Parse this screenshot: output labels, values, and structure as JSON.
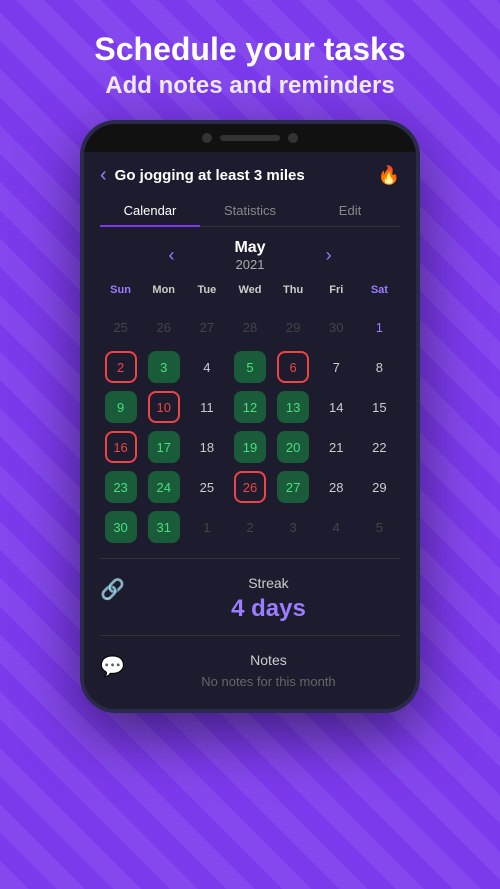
{
  "header": {
    "headline": "Schedule your tasks",
    "subheadline": "Add notes and reminders"
  },
  "app": {
    "title": "Go jogging at least 3 miles",
    "back_label": "‹",
    "flame_icon": "🔥",
    "tabs": [
      {
        "id": "calendar",
        "label": "Calendar",
        "active": true
      },
      {
        "id": "statistics",
        "label": "Statistics",
        "active": false
      },
      {
        "id": "edit",
        "label": "Edit",
        "active": false
      }
    ],
    "calendar": {
      "month": "May",
      "year": "2021",
      "prev_icon": "‹",
      "next_icon": "›",
      "day_headers": [
        "Sun",
        "Mon",
        "Tue",
        "Wed",
        "Thu",
        "Fri",
        "Sat"
      ],
      "weeks": [
        [
          {
            "day": "25",
            "type": "inactive"
          },
          {
            "day": "26",
            "type": "inactive"
          },
          {
            "day": "27",
            "type": "inactive"
          },
          {
            "day": "28",
            "type": "inactive"
          },
          {
            "day": "29",
            "type": "inactive"
          },
          {
            "day": "30",
            "type": "inactive"
          },
          {
            "day": "1",
            "type": "sat"
          }
        ],
        [
          {
            "day": "2",
            "type": "red"
          },
          {
            "day": "3",
            "type": "green"
          },
          {
            "day": "4",
            "type": "normal"
          },
          {
            "day": "5",
            "type": "green"
          },
          {
            "day": "6",
            "type": "red"
          },
          {
            "day": "7",
            "type": "normal"
          },
          {
            "day": "8",
            "type": "normal"
          }
        ],
        [
          {
            "day": "9",
            "type": "green"
          },
          {
            "day": "10",
            "type": "red"
          },
          {
            "day": "11",
            "type": "normal"
          },
          {
            "day": "12",
            "type": "green"
          },
          {
            "day": "13",
            "type": "green"
          },
          {
            "day": "14",
            "type": "normal"
          },
          {
            "day": "15",
            "type": "normal"
          }
        ],
        [
          {
            "day": "16",
            "type": "red"
          },
          {
            "day": "17",
            "type": "green"
          },
          {
            "day": "18",
            "type": "normal"
          },
          {
            "day": "19",
            "type": "green"
          },
          {
            "day": "20",
            "type": "green"
          },
          {
            "day": "21",
            "type": "normal"
          },
          {
            "day": "22",
            "type": "normal"
          }
        ],
        [
          {
            "day": "23",
            "type": "green"
          },
          {
            "day": "24",
            "type": "green"
          },
          {
            "day": "25",
            "type": "normal"
          },
          {
            "day": "26",
            "type": "red"
          },
          {
            "day": "27",
            "type": "green"
          },
          {
            "day": "28",
            "type": "normal"
          },
          {
            "day": "29",
            "type": "normal"
          }
        ],
        [
          {
            "day": "30",
            "type": "green"
          },
          {
            "day": "31",
            "type": "green"
          },
          {
            "day": "1",
            "type": "inactive"
          },
          {
            "day": "2",
            "type": "inactive"
          },
          {
            "day": "3",
            "type": "inactive"
          },
          {
            "day": "4",
            "type": "inactive"
          },
          {
            "day": "5",
            "type": "inactive"
          }
        ]
      ]
    },
    "streak": {
      "label": "Streak",
      "value": "4 days",
      "icon": "🔗"
    },
    "notes": {
      "label": "Notes",
      "empty_message": "No notes for this month",
      "icon": "💬"
    }
  }
}
